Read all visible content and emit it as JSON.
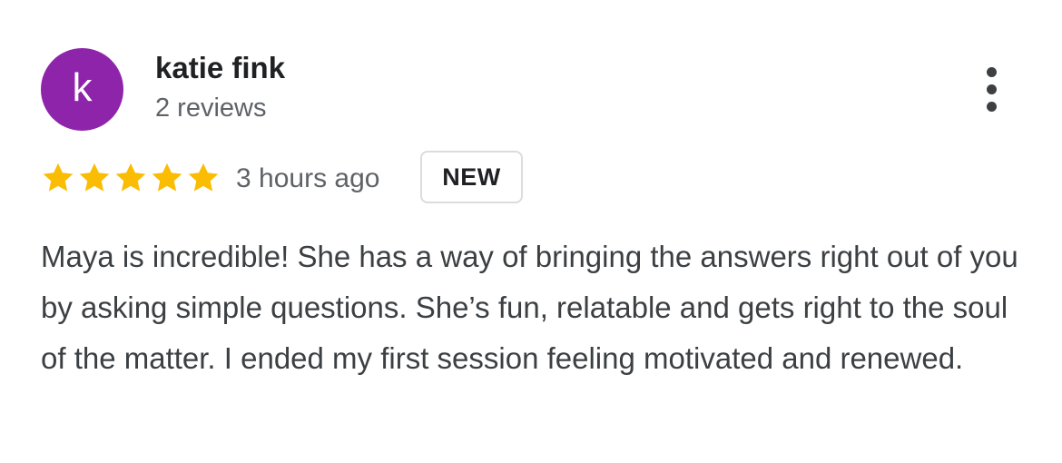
{
  "review": {
    "author": {
      "initial": "k",
      "name": "katie fink",
      "reviews_count": "2 reviews",
      "avatar_color": "#8e24aa"
    },
    "rating": {
      "stars": 5,
      "max": 5,
      "star_color": "#fbbc04"
    },
    "time": "3 hours ago",
    "badge": "NEW",
    "text": "Maya is incredible! She has a way of bringing the answers right out of you by asking simple questions. She’s fun, relatable and gets right to the soul of the matter. I ended my first session feeling motivated and renewed.",
    "menu_icon": "more-vert-icon"
  }
}
